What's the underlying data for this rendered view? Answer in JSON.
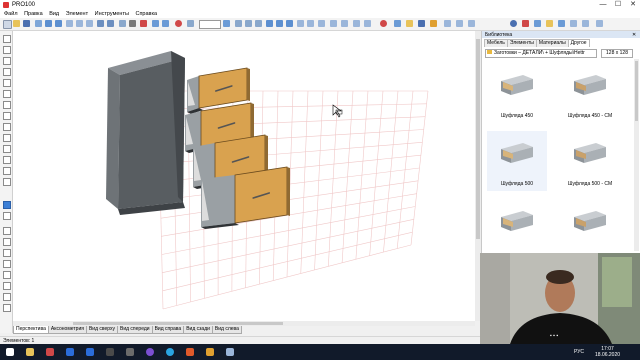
{
  "window": {
    "title": "PRO100",
    "min": "—",
    "max": "☐",
    "close": "✕"
  },
  "menu": [
    "Файл",
    "Правка",
    "Вид",
    "Элемент",
    "Инструменты",
    "Справка"
  ],
  "toolbar_icons": [
    "new-icon",
    "open-icon",
    "save-icon",
    "print-icon",
    "undo-icon",
    "redo-icon",
    "cut-icon",
    "copy-icon",
    "paste-icon",
    "delete-icon",
    "group-icon",
    "ungroup-icon",
    "align-icon",
    "snap-icon",
    "properties-icon",
    "zoom-in-icon",
    "zoom-out-icon",
    "color-icon",
    "render-icon",
    "help-icon"
  ],
  "view_tabs": [
    "Перспектива",
    "Аксонометрия",
    "Вид сверху",
    "Вид спереди",
    "Вид справа",
    "Вид сзади",
    "Вид слева"
  ],
  "active_view": "Перспектива",
  "status": "Элементов: 1",
  "library": {
    "title": "Библиотека",
    "close": "✕",
    "tabs": [
      "Мебель",
      "Элементы",
      "Материалы",
      "Другое"
    ],
    "active_tab": "Другое",
    "path": "Заготовки – ДЕТАЛИ\\ + Шуфляды\\Hettr",
    "size": "128 x 128",
    "items": [
      {
        "name": "Шуфляда 450"
      },
      {
        "name": "Шуфляда 450 - СМ"
      },
      {
        "name": "Шуфляда 500"
      },
      {
        "name": "Шуфляда 500 - СМ"
      },
      {
        "name": ""
      },
      {
        "name": ""
      }
    ]
  },
  "taskbar": {
    "lang": "РУС",
    "time": "17:07",
    "date": "18.06.2020"
  },
  "colors": {
    "cabinet": "#555a5e",
    "drawer_front": "#d9a24f",
    "grid": "#f0c8c8",
    "accent": "#3b7fd6"
  }
}
